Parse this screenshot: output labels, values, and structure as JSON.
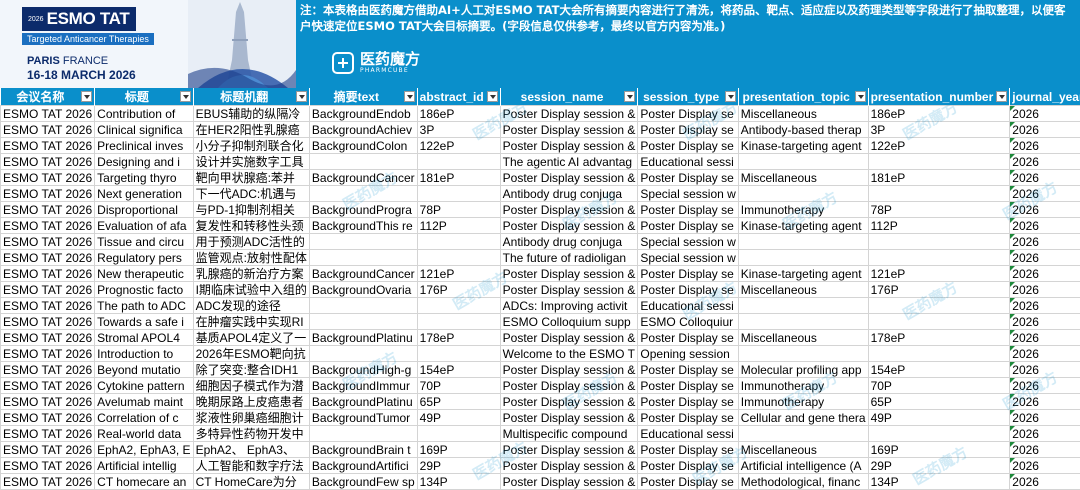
{
  "poster": {
    "year": "2026",
    "name": "ESMO TAT",
    "subtitle": "Targeted Anticancer Therapies",
    "city": "PARIS",
    "country": "FRANCE",
    "dates": "16-18 MARCH 2026"
  },
  "note": "注：本表格由医药魔方借助AI+人工对ESMO TAT大会所有摘要内容进行了清洗，将药品、靶点、适应症以及药理类型等字段进行了抽取整理，以便客户快速定位ESMO TAT大会目标摘要。(字段信息仅供参考，最终以官方内容为准。)",
  "brand": {
    "name": "医药魔方",
    "sub": "PHARMCUBE"
  },
  "watermark": "医药魔方",
  "columns": [
    "会议名称",
    "标题",
    "标题机翻",
    "摘要text",
    "abstract_id",
    "session_name",
    "session_type",
    "presentation_topic",
    "presentation_number",
    "journal_year"
  ],
  "rows": [
    [
      "ESMO TAT 2026",
      "Contribution of",
      "EBUS辅助的纵隔冷",
      "BackgroundEndob",
      "186eP",
      "Poster Display session &",
      "Poster Display se",
      "Miscellaneous",
      "186eP",
      "2026"
    ],
    [
      "ESMO TAT 2026",
      "Clinical significa",
      "在HER2阳性乳腺癌",
      "BackgroundAchiev",
      "3P",
      "Poster Display session &",
      "Poster Display se",
      "Antibody-based therap",
      "3P",
      "2026"
    ],
    [
      "ESMO TAT 2026",
      "Preclinical inves",
      "小分子抑制剂联合化",
      "BackgroundColon",
      "122eP",
      "Poster Display session &",
      "Poster Display se",
      "Kinase-targeting agent",
      "122eP",
      "2026"
    ],
    [
      "ESMO TAT 2026",
      "Designing and i",
      "设计并实施数字工具",
      "",
      "",
      "The agentic AI advantag",
      "Educational sessi",
      "",
      "",
      "2026"
    ],
    [
      "ESMO TAT 2026",
      "Targeting thyro",
      "靶向甲状腺癌:苯并",
      "BackgroundCancer",
      "181eP",
      "Poster Display session &",
      "Poster Display se",
      "Miscellaneous",
      "181eP",
      "2026"
    ],
    [
      "ESMO TAT 2026",
      "Next generation",
      "下一代ADC:机遇与",
      "",
      "",
      "Antibody drug conjuga",
      "Special session w",
      "",
      "",
      "2026"
    ],
    [
      "ESMO TAT 2026",
      "Disproportional",
      "与PD-1抑制剂相关",
      "BackgroundProgra",
      "78P",
      "Poster Display session &",
      "Poster Display se",
      "Immunotherapy",
      "78P",
      "2026"
    ],
    [
      "ESMO TAT 2026",
      "Evaluation of afa",
      "复发性和转移性头颈",
      "BackgroundThis re",
      "112P",
      "Poster Display session &",
      "Poster Display se",
      "Kinase-targeting agent",
      "112P",
      "2026"
    ],
    [
      "ESMO TAT 2026",
      "Tissue and circu",
      "用于预测ADC活性的",
      "",
      "",
      "Antibody drug conjuga",
      "Special session w",
      "",
      "",
      "2026"
    ],
    [
      "ESMO TAT 2026",
      "Regulatory pers",
      "监管观点:放射性配体",
      "",
      "",
      "The future of radioligan",
      "Special session w",
      "",
      "",
      "2026"
    ],
    [
      "ESMO TAT 2026",
      "New therapeutic",
      "乳腺癌的新治疗方案",
      "BackgroundCancer",
      "121eP",
      "Poster Display session &",
      "Poster Display se",
      "Kinase-targeting agent",
      "121eP",
      "2026"
    ],
    [
      "ESMO TAT 2026",
      "Prognostic facto",
      "I期临床试验中入组的",
      "BackgroundOvaria",
      "176P",
      "Poster Display session &",
      "Poster Display se",
      "Miscellaneous",
      "176P",
      "2026"
    ],
    [
      "ESMO TAT 2026",
      "The path to ADC",
      "ADC发现的途径",
      "",
      "",
      "ADCs: Improving activit",
      "Educational sessi",
      "",
      "",
      "2026"
    ],
    [
      "ESMO TAT 2026",
      "Towards a safe i",
      "在肿瘤实践中实现RI",
      "",
      "",
      "ESMO Colloquium supp",
      "ESMO Colloquiur",
      "",
      "",
      "2026"
    ],
    [
      "ESMO TAT 2026",
      "Stromal APOL4",
      "基质APOL4定义了一",
      "BackgroundPlatinu",
      "178eP",
      "Poster Display session &",
      "Poster Display se",
      "Miscellaneous",
      "178eP",
      "2026"
    ],
    [
      "ESMO TAT 2026",
      "Introduction to",
      "2026年ESMO靶向抗",
      "",
      "",
      "Welcome to the ESMO T",
      "Opening session",
      "",
      "",
      "2026"
    ],
    [
      "ESMO TAT 2026",
      "Beyond mutatio",
      "除了突变:整合IDH1",
      "BackgroundHigh-g",
      "154eP",
      "Poster Display session &",
      "Poster Display se",
      "Molecular profiling app",
      "154eP",
      "2026"
    ],
    [
      "ESMO TAT 2026",
      "Cytokine pattern",
      "细胞因子模式作为潜",
      "BackgroundImmur",
      "70P",
      "Poster Display session &",
      "Poster Display se",
      "Immunotherapy",
      "70P",
      "2026"
    ],
    [
      "ESMO TAT 2026",
      "Avelumab maint",
      "晚期尿路上皮癌患者",
      "BackgroundPlatinu",
      "65P",
      "Poster Display session &",
      "Poster Display se",
      "Immunotherapy",
      "65P",
      "2026"
    ],
    [
      "ESMO TAT 2026",
      "Correlation of c",
      "浆液性卵巢癌细胞计",
      "BackgroundTumor",
      "49P",
      "Poster Display session &",
      "Poster Display se",
      "Cellular and gene thera",
      "49P",
      "2026"
    ],
    [
      "ESMO TAT 2026",
      "Real-world data",
      "多特异性药物开发中",
      "",
      "",
      "Multispecific compound",
      "Educational sessi",
      "",
      "",
      "2026"
    ],
    [
      "ESMO TAT 2026",
      "EphA2, EphA3, E",
      "EphA2、 EphA3、",
      "BackgroundBrain t",
      "169P",
      "Poster Display session &",
      "Poster Display se",
      "Miscellaneous",
      "169P",
      "2026"
    ],
    [
      "ESMO TAT 2026",
      "Artificial intellig",
      "人工智能和数字疗法",
      "BackgroundArtifici",
      "29P",
      "Poster Display session &",
      "Poster Display se",
      "Artificial intelligence (A",
      "29P",
      "2026"
    ],
    [
      "ESMO TAT 2026",
      "CT homecare an",
      "CT HomeCare为分",
      "BackgroundFew sp",
      "134P",
      "Poster Display session &",
      "Poster Display se",
      "Methodological, financ",
      "134P",
      "2026"
    ]
  ]
}
